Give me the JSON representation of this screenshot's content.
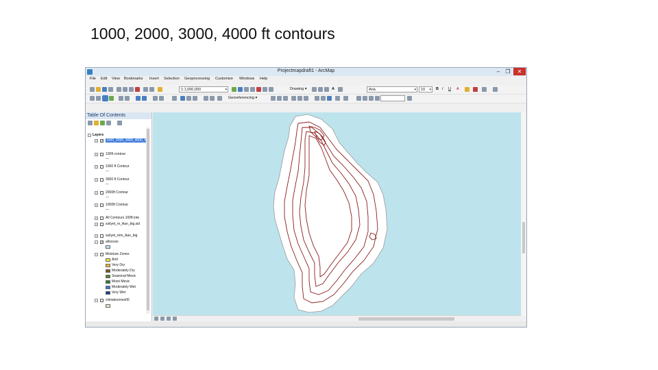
{
  "slide": {
    "title": "1000, 2000, 3000, 4000 ft contours"
  },
  "window": {
    "title": "Projectmapdraft1 - ArcMap",
    "controls": {
      "minimize": "–",
      "maximize": "❐",
      "close": "✕"
    }
  },
  "menu": [
    "File",
    "Edit",
    "View",
    "Bookmarks",
    "Insert",
    "Selection",
    "Geoprocessing",
    "Customize",
    "Windows",
    "Help"
  ],
  "toolbar": {
    "scale": "1:1,000,000",
    "drawing_label": "Drawing ▾",
    "font_name": "Aria",
    "font_size": "10",
    "bold": "B",
    "italic": "I",
    "underline": "U",
    "font_color": "A",
    "georeferencing_label": "Georeferencing ▾"
  },
  "toc": {
    "title": "Table Of Contents",
    "layers_root": "Layers",
    "items": [
      {
        "label": "1000_2000_3000_4000_ft",
        "checked": "✓",
        "selected": true
      },
      {
        "label": "100ft contour",
        "checked": ""
      },
      {
        "label": "1000 ft Contour",
        "checked": ""
      },
      {
        "label": "3000 ft Contour",
        "checked": ""
      },
      {
        "label": "2000ft Contour",
        "checked": ""
      },
      {
        "label": "1000ft Contour",
        "checked": ""
      },
      {
        "label": "All Contours 100ft inte",
        "checked": ""
      },
      {
        "label": "soilyet_m_Aan_big.sid",
        "checked": ""
      },
      {
        "label": "soilyet_mm_Aan_big",
        "checked": ""
      },
      {
        "label": "allocean",
        "checked": "✓"
      },
      {
        "label": "Moisture Zones",
        "checked": ""
      },
      {
        "label": "climatezones06",
        "checked": ""
      }
    ],
    "legend": [
      {
        "label": "Arid",
        "color": "#f2e53c"
      },
      {
        "label": "Very Dry",
        "color": "#e7b832"
      },
      {
        "label": "Moderately Dry",
        "color": "#7a5522"
      },
      {
        "label": "Seasonal Mesic",
        "color": "#5b7f2a"
      },
      {
        "label": "Moist Mesic",
        "color": "#2f7a3a"
      },
      {
        "label": "Moderately Wet",
        "color": "#3b78c7"
      },
      {
        "label": "Very Wet",
        "color": "#1c3f8a"
      }
    ]
  },
  "map": {
    "ocean_color": "#bde3ed",
    "land_color": "#ffffff",
    "contour_color": "#8b1a1a"
  }
}
